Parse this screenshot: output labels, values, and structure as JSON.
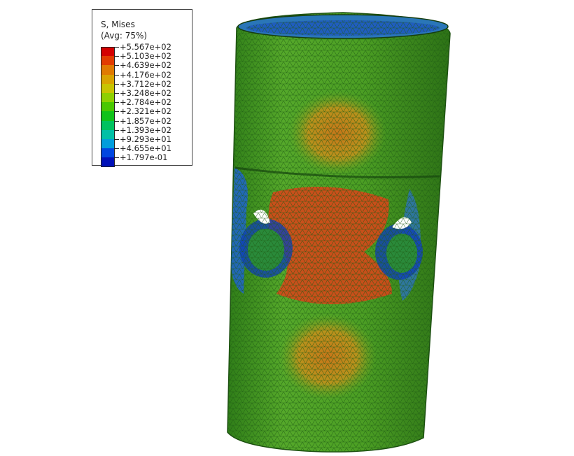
{
  "legend": {
    "title": "S, Mises",
    "subtitle": "(Avg: 75%)",
    "levels": [
      {
        "label": "+5.567e+02",
        "color": "#d40000"
      },
      {
        "label": "+5.103e+02",
        "color": "#e23b00"
      },
      {
        "label": "+4.639e+02",
        "color": "#e07a00"
      },
      {
        "label": "+4.176e+02",
        "color": "#d9a300"
      },
      {
        "label": "+3.712e+02",
        "color": "#c8c400"
      },
      {
        "label": "+3.248e+02",
        "color": "#8ed000"
      },
      {
        "label": "+2.784e+02",
        "color": "#49c800"
      },
      {
        "label": "+2.321e+02",
        "color": "#10c21a"
      },
      {
        "label": "+1.857e+02",
        "color": "#00c25f"
      },
      {
        "label": "+1.393e+02",
        "color": "#00c0a6"
      },
      {
        "label": "+9.293e+01",
        "color": "#009ddc"
      },
      {
        "label": "+4.655e+01",
        "color": "#0046e0"
      },
      {
        "label": "+1.797e-01",
        "color": "#0010b8"
      }
    ]
  },
  "colors": {
    "mesh_green": "#3d9a1f",
    "mesh_dark": "#1f5c14",
    "hotspot_red": "#d6401a",
    "hotspot_orange": "#c87a1e",
    "low_blue": "#1e5fd0",
    "background": "#ffffff"
  }
}
